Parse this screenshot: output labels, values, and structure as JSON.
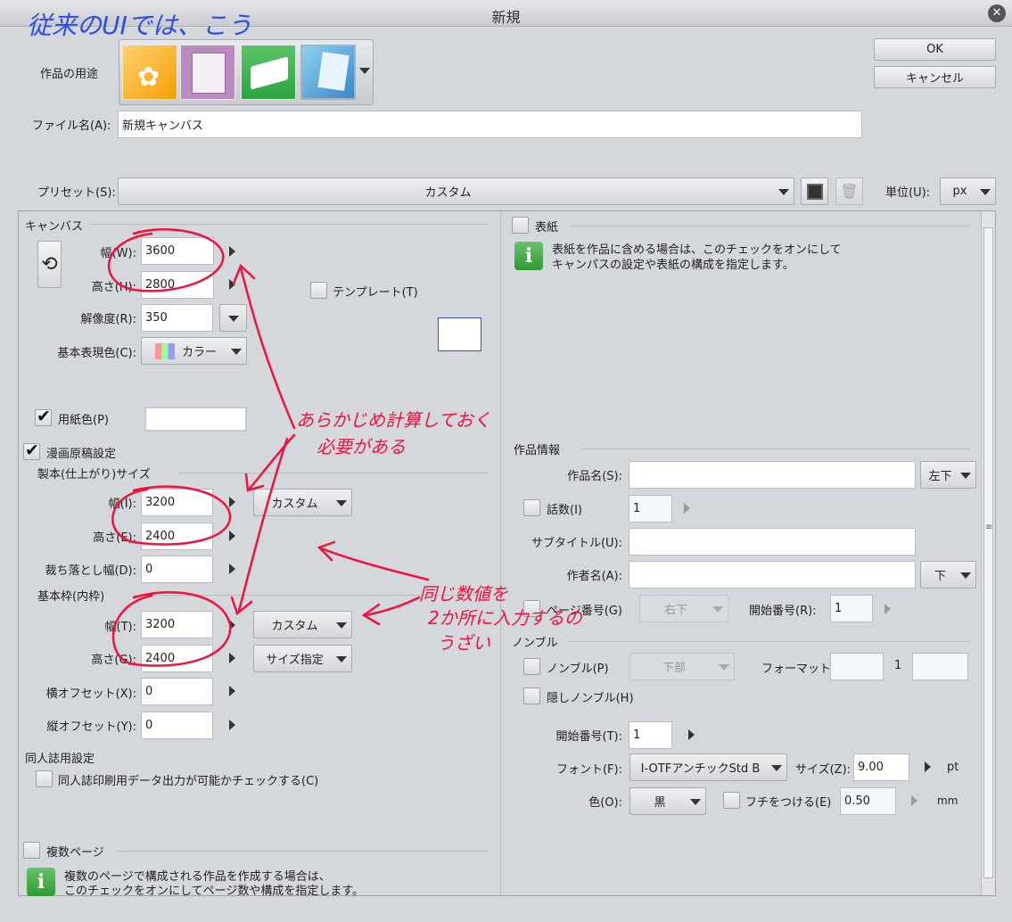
{
  "window": {
    "title": "新規"
  },
  "top": {
    "usage_label": "作品の用途",
    "usage_icons": [
      "illustration-icon",
      "comic-icon",
      "book-icon",
      "all-comic-icon"
    ],
    "ok": "OK",
    "cancel": "キャンセル",
    "filename_label": "ファイル名(A):",
    "filename_value": "新規キャンバス",
    "preset_label": "プリセット(S):",
    "preset_value": "カスタム",
    "unit_label": "単位(U):",
    "unit_value": "px"
  },
  "canvas": {
    "heading": "キャンバス",
    "width_label": "幅(W):",
    "width_value": "3600",
    "height_label": "高さ(H):",
    "height_value": "2800",
    "template_label": "テンプレート(T)",
    "resolution_label": "解像度(R):",
    "resolution_value": "350",
    "color_label": "基本表現色(C):",
    "color_value": "カラー",
    "paper_label": "用紙色(P)"
  },
  "manga": {
    "label": "漫画原稿設定",
    "bind_heading": "製本(仕上がり)サイズ",
    "bind_w_label": "幅(I):",
    "bind_w_value": "3200",
    "bind_w_preset": "カスタム",
    "bind_h_label": "高さ(E):",
    "bind_h_value": "2400",
    "bleed_label": "裁ち落とし幅(D):",
    "bleed_value": "0",
    "frame_heading": "基本枠(内枠)",
    "frame_w_label": "幅(T):",
    "frame_w_value": "3200",
    "frame_w_preset": "カスタム",
    "frame_h_label": "高さ(G):",
    "frame_h_value": "2400",
    "frame_h_preset": "サイズ指定",
    "offx_label": "横オフセット(X):",
    "offx_value": "0",
    "offy_label": "縦オフセット(Y):",
    "offy_value": "0"
  },
  "doujin": {
    "heading": "同人誌用設定",
    "check_label": "同人誌印刷用データ出力が可能かチェックする(C)"
  },
  "multipage": {
    "label": "複数ページ",
    "info1": "複数のページで構成される作品を作成する場合は、",
    "info2": "このチェックをオンにしてページ数や構成を指定します。"
  },
  "cover": {
    "label": "表紙",
    "info1": "表紙を作品に含める場合は、このチェックをオンにして",
    "info2": "キャンパスの設定や表紙の構成を指定します。"
  },
  "work_info": {
    "heading": "作品情報",
    "title_label": "作品名(S):",
    "title_pos": "左下",
    "episode_label": "話数(I)",
    "episode_value": "1",
    "subtitle_label": "サブタイトル(U):",
    "author_label": "作者名(A):",
    "author_pos": "下",
    "page_label": "ページ番号(G)",
    "page_pos": "右下",
    "start_label": "開始番号(R):",
    "start_value": "1"
  },
  "nombre": {
    "heading": "ノンブル",
    "nombre_label": "ノンブル(P)",
    "nombre_pos": "下部",
    "format_label": "フォーマット:",
    "format_mid": "1",
    "hidden_label": "隠しノンブル(H)",
    "start_label": "開始番号(T):",
    "start_value": "1",
    "font_label": "フォント(F):",
    "font_value": "I-OTFアンチックStd B",
    "size_label": "サイズ(Z):",
    "size_value": "9.00",
    "size_unit": "pt",
    "color_label": "色(O):",
    "color_value": "黒",
    "edge_label": "フチをつける(E)",
    "edge_value": "0.50",
    "edge_unit": "mm"
  },
  "annotations": {
    "blue_note": "従来のUIでは、こう",
    "red_note1a": "あらかじめ計算しておく",
    "red_note1b": "必要がある",
    "red_note2a": "同じ数値を",
    "red_note2b": "2か所に入力するの",
    "red_note2c": "うざい"
  },
  "colors": {
    "blue_ink": "#2d4fe0",
    "red_ink": "#f0123c"
  }
}
